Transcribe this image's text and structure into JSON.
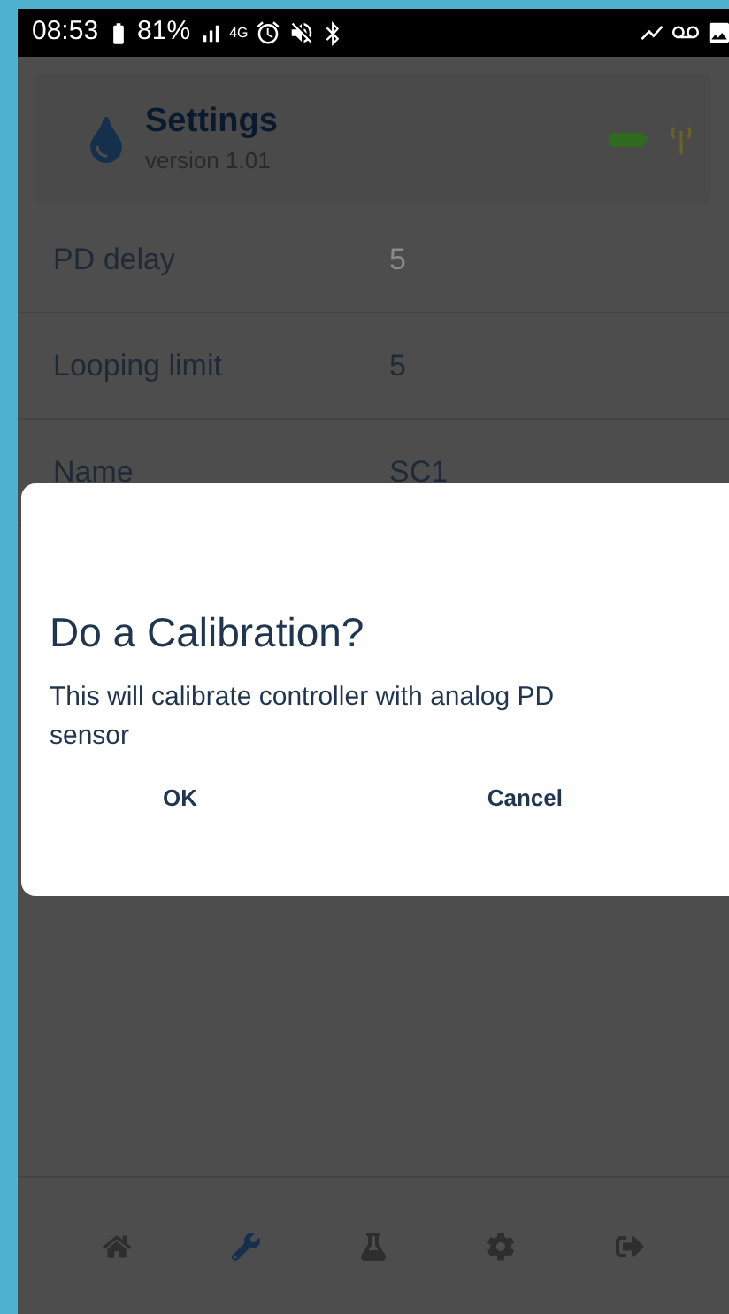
{
  "status_bar": {
    "time": "08:53",
    "battery": "81%",
    "network": "4G"
  },
  "header": {
    "title": "Settings",
    "subtitle": "version 1.01",
    "battery_ok": true
  },
  "settings": [
    {
      "label": "PD delay",
      "value": "5",
      "dimmed": true
    },
    {
      "label": "Looping limit",
      "value": "5",
      "dimmed": false
    },
    {
      "label": "Name",
      "value": "SC1",
      "dimmed": false
    }
  ],
  "dialog": {
    "title": "Do a Calibration?",
    "message": "This will calibrate controller with analog PD sensor",
    "buttons": [
      "OK",
      "Cancel"
    ]
  },
  "nav": [
    {
      "kind": "home",
      "selected": false
    },
    {
      "kind": "wrench",
      "selected": true
    },
    {
      "kind": "flask",
      "selected": false
    },
    {
      "kind": "gear",
      "selected": false
    },
    {
      "kind": "exit",
      "selected": false
    }
  ]
}
